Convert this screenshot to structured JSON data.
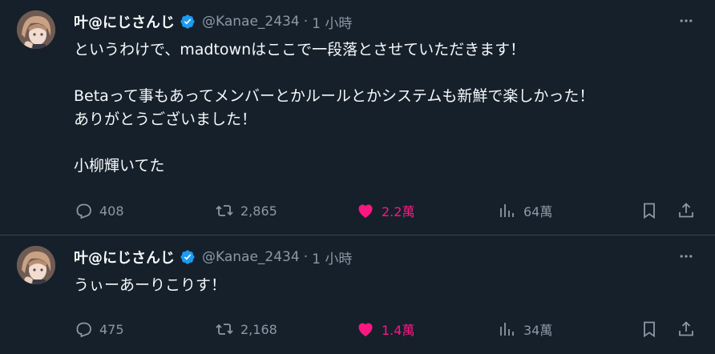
{
  "colors": {
    "background": "#15202b",
    "text": "#f7f9f9",
    "muted": "#8b98a5",
    "like": "#f91880",
    "verified": "#1d9bf0",
    "divider": "#38444d"
  },
  "tweets": [
    {
      "author": "叶@にじさんじ",
      "handle": "@Kanae_2434",
      "separator": "·",
      "time": "1 小時",
      "lines": [
        "というわけで、madtownはここで一段落とさせていただきます！",
        "Betaって事もあってメンバーとかルールとかシステムも新鮮で楽しかった！",
        "ありがとうございました！",
        "小柳輝いてた"
      ],
      "replies": "408",
      "retweets": "2,865",
      "likes": "2.2萬",
      "views": "64萬",
      "liked": true
    },
    {
      "author": "叶@にじさんじ",
      "handle": "@Kanae_2434",
      "separator": "·",
      "time": "1 小時",
      "lines": [
        "うぃーあーりこりす！"
      ],
      "replies": "475",
      "retweets": "2,168",
      "likes": "1.4萬",
      "views": "34萬",
      "liked": true
    }
  ],
  "icons": [
    "verified-badge-icon",
    "more-icon",
    "reply-icon",
    "retweet-icon",
    "heart-icon",
    "views-icon",
    "bookmark-icon",
    "share-icon"
  ]
}
